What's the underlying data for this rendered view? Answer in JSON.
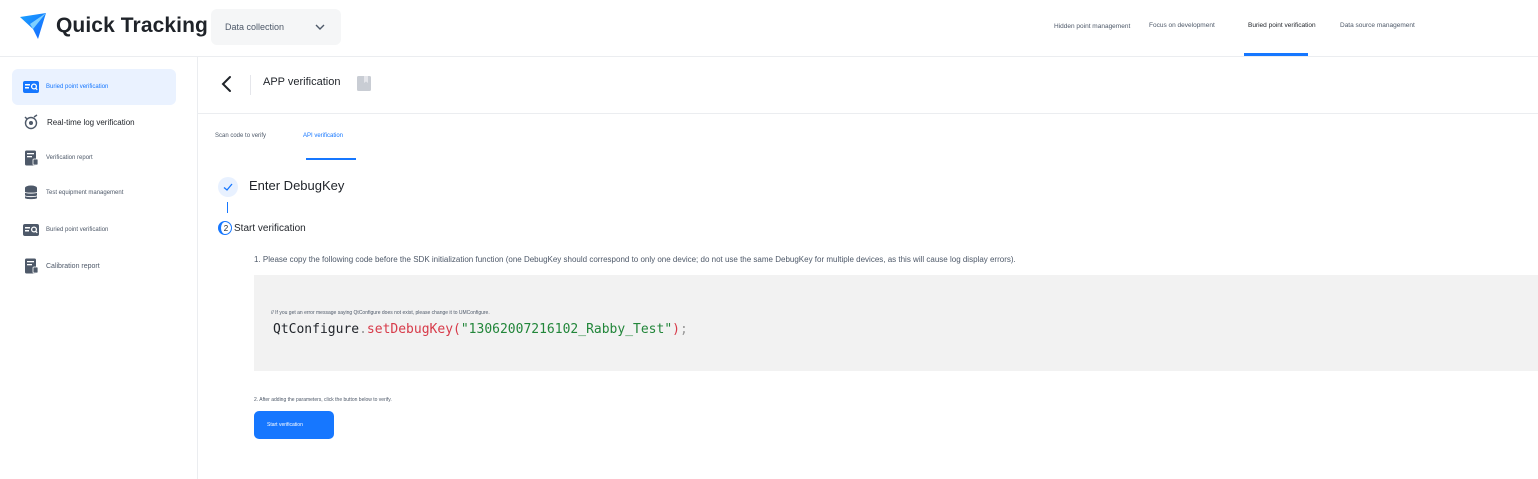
{
  "brand": {
    "name": "Quick Tracking",
    "accent": "#1677ff"
  },
  "app_select": {
    "value": "Data collection"
  },
  "topnav": {
    "items": [
      {
        "label": "Hidden point management"
      },
      {
        "label": "Focus on development"
      },
      {
        "label": "Buried point verification"
      },
      {
        "label": "Data source management"
      }
    ],
    "active_index": 2
  },
  "sidebar": {
    "items": [
      {
        "label": "Buried point verification",
        "icon": "verify-icon",
        "active": true
      },
      {
        "label": "Real-time log verification",
        "icon": "realtime-icon"
      },
      {
        "label": "Verification report",
        "icon": "report-icon"
      },
      {
        "label": "Test equipment management",
        "icon": "database-icon"
      },
      {
        "label": "Buried point verification",
        "icon": "verify-icon"
      },
      {
        "label": "Calibration report",
        "icon": "report-icon"
      }
    ]
  },
  "header": {
    "title": "APP verification"
  },
  "tabs": [
    {
      "label": "Scan code to verify"
    },
    {
      "label": "API verification",
      "active": true
    }
  ],
  "steps": [
    {
      "label": "Enter DebugKey",
      "status": "done"
    },
    {
      "number": "2",
      "label": "Start verification",
      "status": "current"
    }
  ],
  "instructions": {
    "step1": "1. Please copy the following code before the SDK initialization function (one DebugKey should correspond to only one device; do not use the same DebugKey for multiple devices, as this will cause log display errors).",
    "step2": "2. After adding the parameters, click the button below to verify."
  },
  "code": {
    "comment": "// If you get an error message saying QtConfigure does not exist, please change it to UMConfigure.",
    "object": "QtConfigure",
    "dot": ".",
    "method": "setDebugKey",
    "open": "(",
    "arg": "\"13062007216102_Rabby_Test\"",
    "close": ")",
    "semi": ";"
  },
  "start_button": {
    "label": "Start verification"
  }
}
